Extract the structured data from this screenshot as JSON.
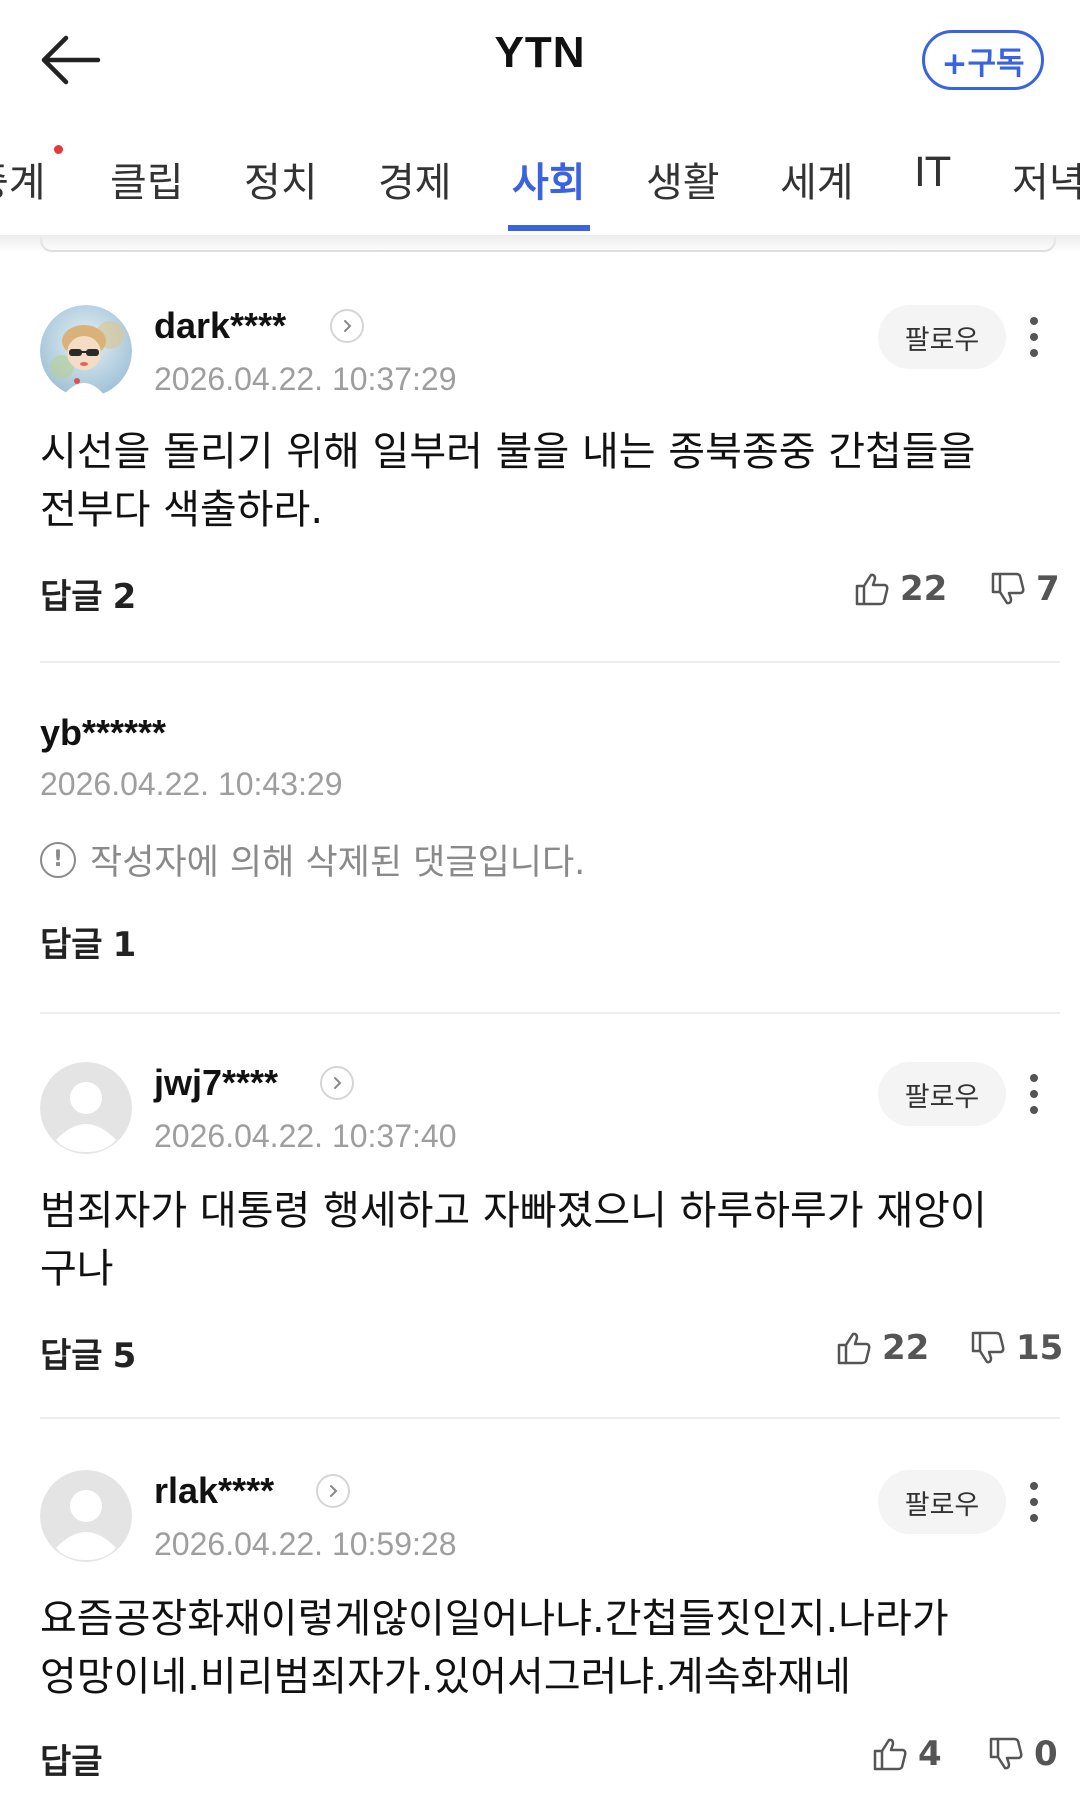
{
  "header": {
    "title": "YTN",
    "subscribe_label": "+구독"
  },
  "tabs": [
    {
      "label": "중계",
      "active": false,
      "has_dot": true
    },
    {
      "label": "클립",
      "active": false
    },
    {
      "label": "정치",
      "active": false
    },
    {
      "label": "경제",
      "active": false
    },
    {
      "label": "사회",
      "active": true
    },
    {
      "label": "생활",
      "active": false
    },
    {
      "label": "세계",
      "active": false
    },
    {
      "label": "IT",
      "active": false
    },
    {
      "label": "저녁",
      "active": false
    }
  ],
  "colors": {
    "accent": "#3a63e0",
    "notification_dot": "#e53935",
    "timestamp_gray": "#9e9e9e"
  },
  "comments": [
    {
      "username": "dark****",
      "timestamp": "2026.04.22. 10:37:29",
      "follow_label": "팔로우",
      "text_line1": "시선을 돌리기 위해 일부러 불을 내는 종북종중 간첩들을",
      "text_line2": "전부다 색출하라.",
      "reply_label": "답글",
      "reply_count": "2",
      "likes": "22",
      "dislikes": "7",
      "avatar": "profile-photo"
    },
    {
      "username": "yb******",
      "timestamp": "2026.04.22. 10:43:29",
      "deleted_text": "작성자에 의해 삭제된 댓글입니다.",
      "reply_label": "답글",
      "reply_count": "1"
    },
    {
      "username": "jwj7****",
      "timestamp": "2026.04.22. 10:37:40",
      "follow_label": "팔로우",
      "text_line1": "범죄자가 대통령 행세하고 자빠졌으니 하루하루가 재앙이",
      "text_line2": "구나",
      "reply_label": "답글",
      "reply_count": "5",
      "likes": "22",
      "dislikes": "15",
      "avatar": "default-avatar"
    },
    {
      "username": "rlak****",
      "timestamp": "2026.04.22. 10:59:28",
      "follow_label": "팔로우",
      "text_line1": "요즘공장화재이렇게않이일어나냐.간첩들짓인지.나라가",
      "text_line2": "엉망이네.비리범죄자가.있어서그러냐.계속화재네",
      "reply_label": "답글",
      "reply_count": "",
      "likes": "4",
      "dislikes": "0",
      "avatar": "default-avatar"
    }
  ]
}
